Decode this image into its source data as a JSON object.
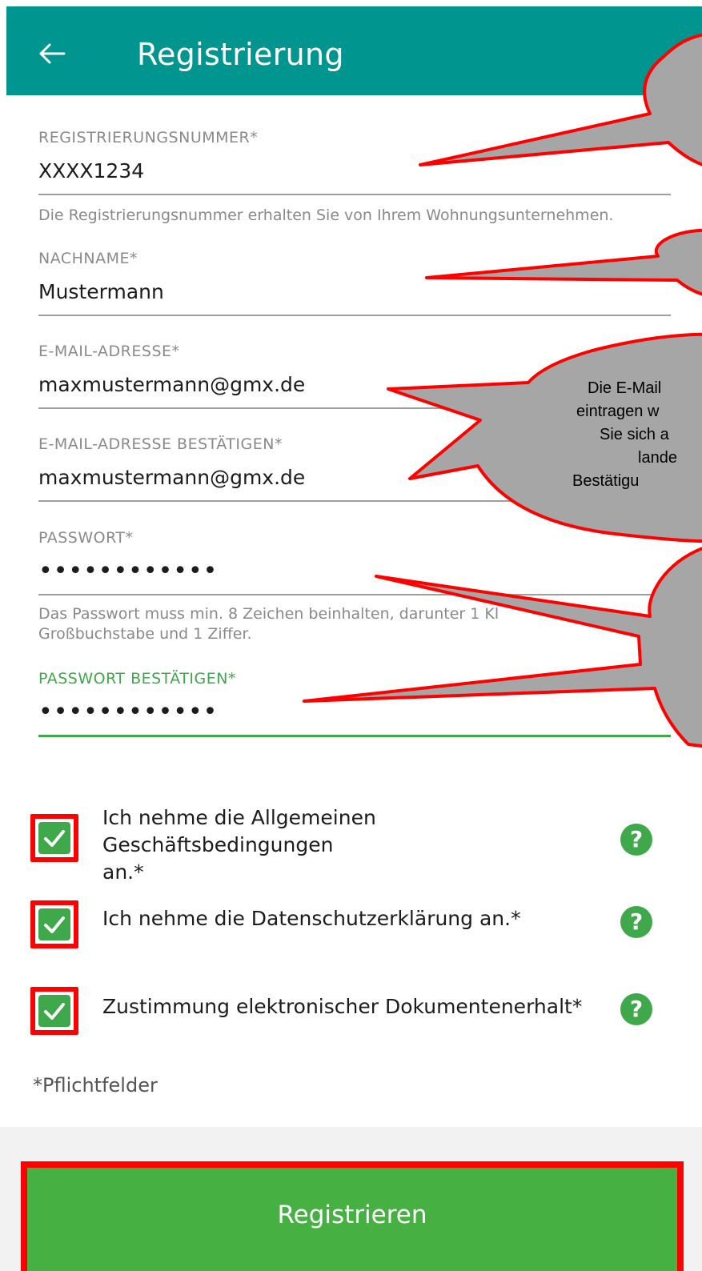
{
  "header": {
    "back_icon": "arrow-left-icon",
    "title": "Registrierung"
  },
  "fields": {
    "registration": {
      "label": "REGISTRIERUNGSNUMMER*",
      "value": "XXXX1234",
      "hint": "Die Registrierungsnummer erhalten Sie von Ihrem Wohnungsunternehmen."
    },
    "lastname": {
      "label": "NACHNAME*",
      "value": "Mustermann"
    },
    "email": {
      "label": "E-MAIL-ADRESSE*",
      "value": "maxmustermann@gmx.de"
    },
    "email_confirm": {
      "label": "E-MAIL-ADRESSE BESTÄTIGEN*",
      "value": "maxmustermann@gmx.de"
    },
    "password": {
      "label": "PASSWORT*",
      "value": "••••••••••••",
      "hint_line1": "Das Passwort muss min. 8 Zeichen beinhalten, darunter 1 Kl",
      "hint_line2": "Großbuchstabe und 1 Ziffer."
    },
    "password_confirm": {
      "label": "PASSWORT BESTÄTIGEN*",
      "value": "••••••••••••"
    }
  },
  "checkboxes": [
    {
      "line1": "Ich nehme die Allgemeinen Geschäftsbedingungen",
      "line2": "an.*",
      "checked": true,
      "help_icon": "question-mark-icon"
    },
    {
      "line1": "Ich nehme die Datenschutzerklärung an.*",
      "checked": true,
      "help_icon": "question-mark-icon"
    },
    {
      "line1": "Zustimmung elektronischer Dokumentenerhalt*",
      "checked": true,
      "help_icon": "question-mark-icon"
    }
  ],
  "help_glyph": "?",
  "required_note": "*Pflichtfelder",
  "register_button": "Registrieren",
  "callout": {
    "lines": [
      "Die E-Mail",
      "eintragen w",
      "Sie sich a",
      "lande",
      "Bestätigu"
    ]
  },
  "colors": {
    "appbar": "#00968f",
    "accent_green": "#3fa84a",
    "button_green": "#46b043",
    "annotation_red": "#ff0000",
    "callout_gray": "#a6a6a6"
  }
}
